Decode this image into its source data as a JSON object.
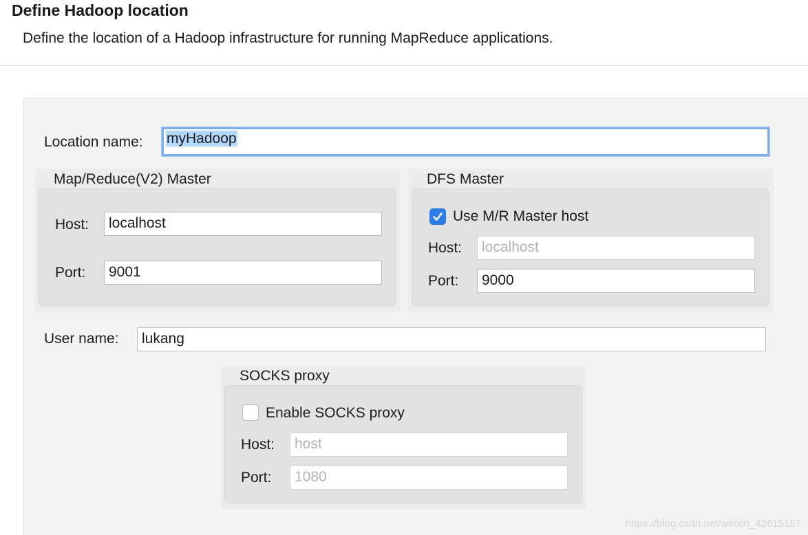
{
  "header": {
    "title": "Define Hadoop location",
    "description": "Define the location of a Hadoop infrastructure for running MapReduce applications."
  },
  "location": {
    "label": "Location name:",
    "value": "myHadoop"
  },
  "mr_master": {
    "title": "Map/Reduce(V2) Master",
    "host_label": "Host:",
    "host_value": "localhost",
    "port_label": "Port:",
    "port_value": "9001"
  },
  "dfs_master": {
    "title": "DFS Master",
    "use_mr_label": "Use M/R Master host",
    "use_mr_checked": true,
    "host_label": "Host:",
    "host_value": "localhost",
    "port_label": "Port:",
    "port_value": "9000"
  },
  "user": {
    "label": "User name:",
    "value": "lukang"
  },
  "socks": {
    "title": "SOCKS proxy",
    "enable_label": "Enable SOCKS proxy",
    "enable_checked": false,
    "host_label": "Host:",
    "host_value": "host",
    "port_label": "Port:",
    "port_value": "1080"
  },
  "watermark": "https://blog.csdn.net/weixin_42615157",
  "colors": {
    "accent": "#2d7be5",
    "focus_ring": "#7eaeea",
    "selection": "#b3d7fe"
  }
}
